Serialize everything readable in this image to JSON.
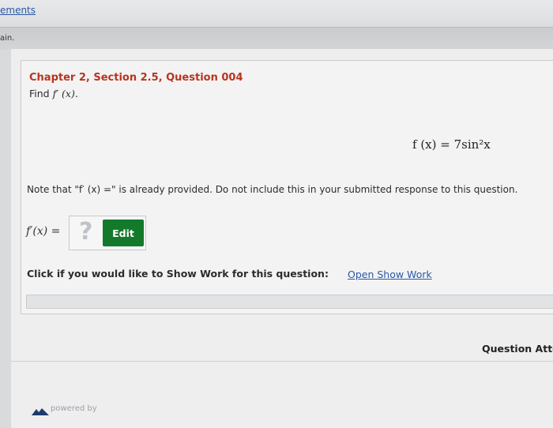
{
  "top": {
    "link_text": "ements"
  },
  "subbar": {
    "text": "ain."
  },
  "question": {
    "title": "Chapter 2, Section 2.5, Question 004",
    "find_prefix": "Find",
    "find_math": "f′ (x)",
    "find_suffix": ".",
    "equation": "f (x) = 7sin²x",
    "note": "Note that \"f′ (x) =\" is already provided. Do not include this in your submitted response to this question.",
    "answer_label": "f′(x) =",
    "answer_placeholder": "?",
    "edit_label": "Edit"
  },
  "show_work": {
    "prompt": "Click if you would like to Show Work for this question:",
    "link": "Open Show Work"
  },
  "footer": {
    "attempts_label": "Question Atte",
    "powered_by": "powered by"
  },
  "colors": {
    "title": "#b8341f",
    "link": "#2a58a8",
    "edit_button": "#137a2c"
  }
}
